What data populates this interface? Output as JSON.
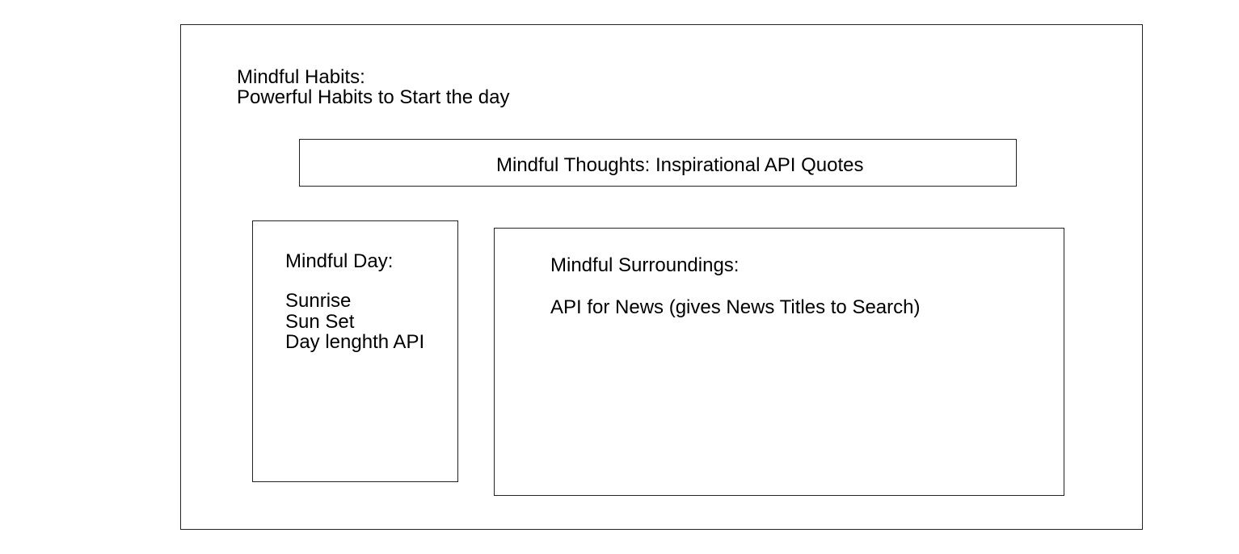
{
  "header": {
    "title": "Mindful Habits:",
    "subtitle": "Powerful Habits to Start the day"
  },
  "quotes_section": {
    "label": "Mindful Thoughts: Inspirational API Quotes"
  },
  "day_section": {
    "heading": "Mindful Day:",
    "items": [
      "Sunrise",
      "Sun Set",
      "Day lenghth API"
    ]
  },
  "news_section": {
    "heading": "Mindful Surroundings:",
    "text": "API for News (gives News Titles to Search)"
  },
  "colors": {
    "border": "#222222",
    "background": "#ffffff",
    "text": "#000000"
  }
}
